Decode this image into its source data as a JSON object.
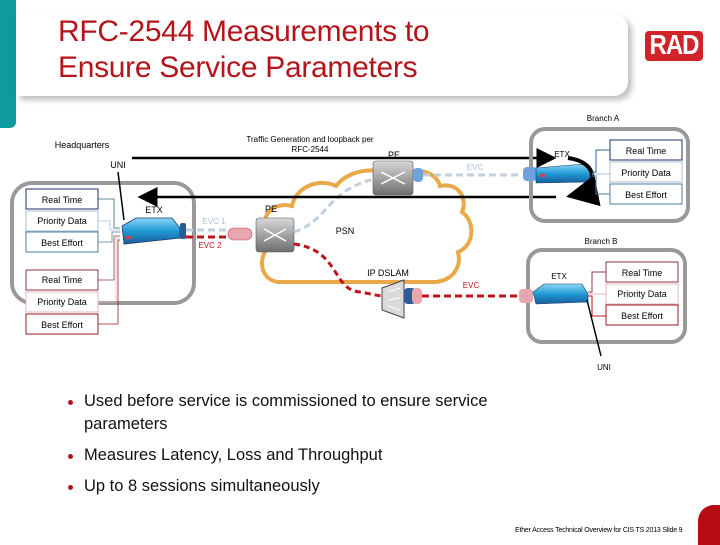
{
  "slide": {
    "title_line1": "RFC-2544 Measurements to",
    "title_line2": "Ensure Service Parameters",
    "logo": "RAD",
    "accent_color": "#b3151b",
    "side_bar_color": "#0e9a9e"
  },
  "diagram": {
    "headquarters": {
      "label": "Headquarters",
      "uni_label": "UNI",
      "etx_label": "ETX",
      "blue_group": [
        "Real Time",
        "Priority Data",
        "Best Effort"
      ],
      "red_group": [
        "Real Time",
        "Priority Data",
        "Best Effort"
      ]
    },
    "traffic_label_line1": "Traffic Generation and loopback per",
    "traffic_label_line2": "RFC-2544",
    "network": {
      "pe_left_label": "PE",
      "pe_top_label": "PE",
      "psn_label": "PSN",
      "dslam_label": "IP DSLAM",
      "evc1_label": "EVC 1",
      "evc2_label": "EVC 2",
      "evc_blue_label": "EVC",
      "evc_red_label": "EVC"
    },
    "branch_a": {
      "label": "Branch A",
      "etx_label": "ETX",
      "services": [
        "Real Time",
        "Priority Data",
        "Best Effort"
      ]
    },
    "branch_b": {
      "label": "Branch B",
      "etx_label": "ETX",
      "uni_label": "UNI",
      "services": [
        "Real Time",
        "Priority Data",
        "Best Effort"
      ]
    },
    "colors": {
      "cloud": "#e9a84a",
      "evc_blue": "#c2cfdc",
      "evc_red": "#c0141c",
      "site_border": "#999999",
      "blue_box": "#1d2f6e",
      "red_box": "#9b1b22"
    }
  },
  "bullets": [
    "Used before service is commissioned to ensure service parameters",
    "Measures Latency, Loss and Throughput",
    "Up to 8 sessions simultaneously"
  ],
  "footer": "Ether Access Technical Overview for CIS TS 2013 Slide 9"
}
